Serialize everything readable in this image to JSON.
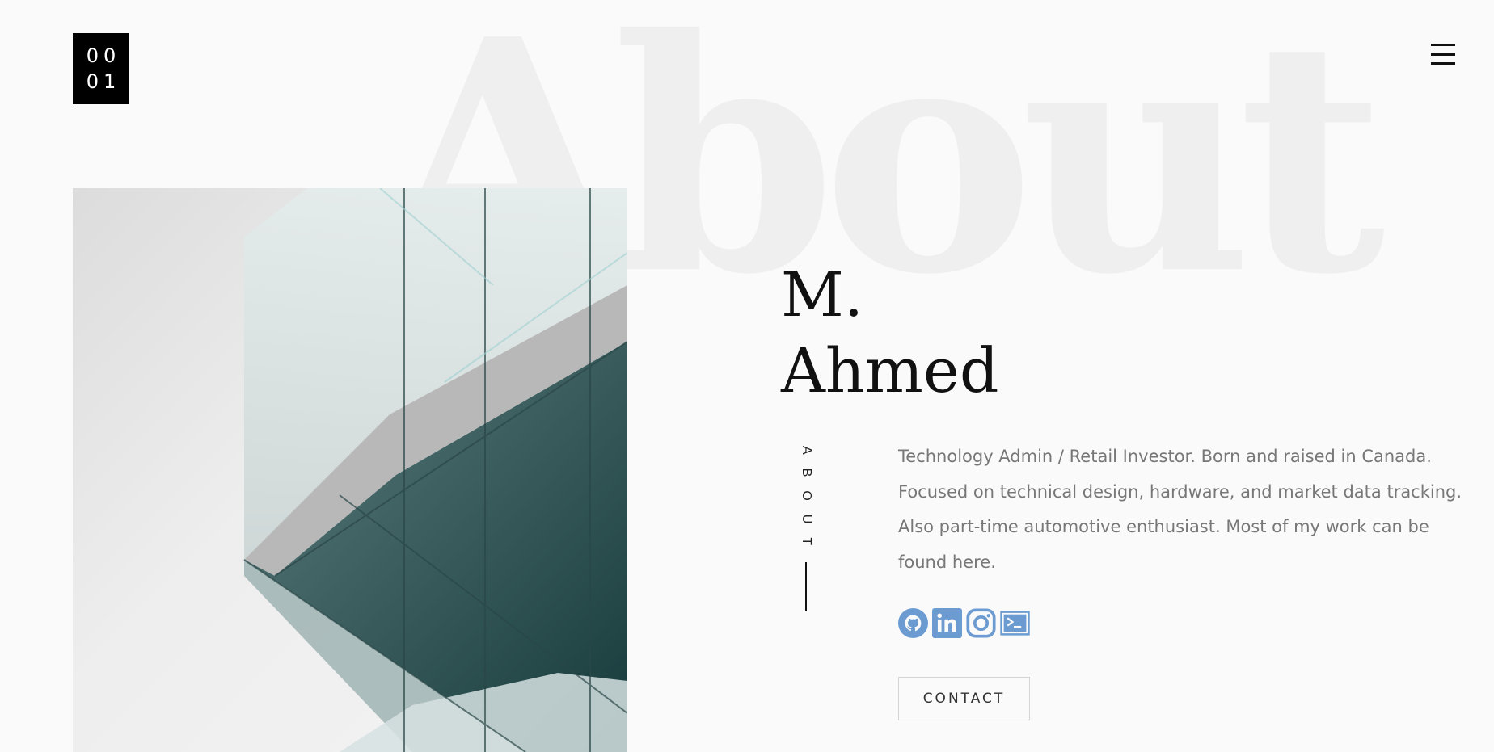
{
  "logo": {
    "line1": "00",
    "line2": "01"
  },
  "background_word": "About",
  "profile": {
    "name_line1": "M.",
    "name_line2": "Ahmed",
    "section_label": "ABOUT",
    "bio": "Technology Admin / Retail Investor. Born and raised in Canada. Focused on technical design, hardware, and market data tracking. Also part-time automotive enthusiast. Most of my work can be found here."
  },
  "socials": [
    {
      "icon": "github-icon"
    },
    {
      "icon": "linkedin-icon"
    },
    {
      "icon": "instagram-icon"
    },
    {
      "icon": "terminal-icon"
    }
  ],
  "contact_label": "CONTACT",
  "colors": {
    "accent": "#6b9bd1",
    "text": "#111111",
    "muted": "#777777",
    "background": "#fafafa"
  }
}
